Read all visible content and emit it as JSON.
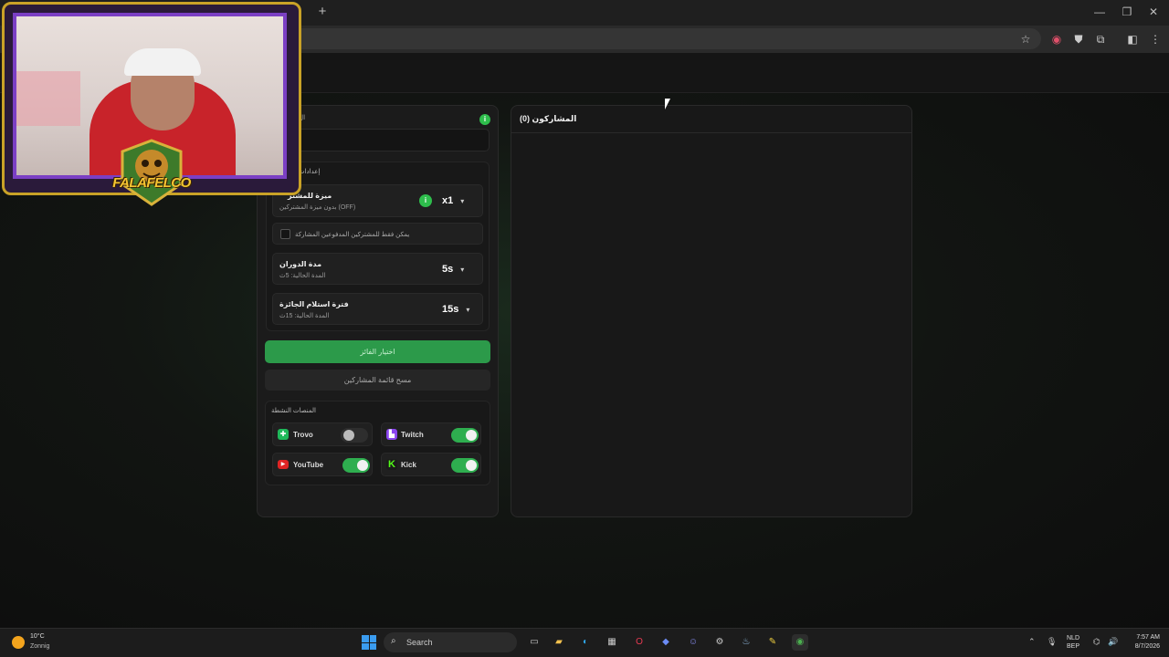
{
  "browser": {
    "new_tab": "+",
    "minimize": "—",
    "restore": "❐",
    "close": "✕",
    "toolbar_icons": [
      "star-icon",
      "extension-icon",
      "shield-icon",
      "puzzle-icon",
      "profile-icon",
      "menu-icon"
    ]
  },
  "left_panel": {
    "title": "ال",
    "info": "i",
    "settings_title": "إعدادات",
    "multiplier": {
      "title": "ميزة للمشتر",
      "subtitle": "بدون ميزة المشتركين (OFF)",
      "value": "x1"
    },
    "subscribers_only_label": "يمكن فقط للمشتركين المدفوعين المشاركة",
    "spin_duration": {
      "title": "مدة الدوران",
      "subtitle": "المدة الحالية: 5ث",
      "value": "5s"
    },
    "claim_period": {
      "title": "فترة استلام الجائزة",
      "subtitle": "المدة الحالية: 15ث",
      "value": "15s"
    },
    "pick_winner": "اختيار الفائز",
    "clear_participants": "مسح قائمة المشاركين",
    "platforms_title": "المنصات النشطة",
    "platforms": [
      {
        "name": "Trovo",
        "enabled": false,
        "color": "#1fb85a"
      },
      {
        "name": "Twitch",
        "enabled": true,
        "color": "#8b45f0"
      },
      {
        "name": "YouTube",
        "enabled": true,
        "color": "#e02424"
      },
      {
        "name": "Kick",
        "enabled": true,
        "color": "#53fc18"
      }
    ]
  },
  "right_panel": {
    "title": "المشاركون (0)"
  },
  "webcam": {
    "logo_text": "FALAFELCO"
  },
  "taskbar": {
    "weather_temp": "10°C",
    "weather_cond": "Zonnig",
    "search_label": "Search",
    "lang_top": "NLD",
    "lang_bottom": "BEP",
    "time": "7:57 AM",
    "date": "8/7/2026"
  },
  "colors": {
    "accent": "#2c9a4a",
    "twitch": "#8b45f0",
    "youtube": "#e02424",
    "kick": "#53fc18"
  }
}
